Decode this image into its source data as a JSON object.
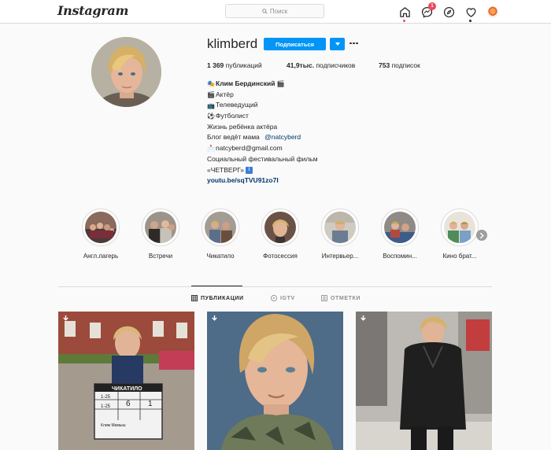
{
  "header": {
    "logo": "Instagram",
    "search_placeholder": "Поиск",
    "icons": [
      "home-icon",
      "messenger-icon",
      "explore-icon",
      "heart-icon",
      "avatar"
    ],
    "dm_badge": "1"
  },
  "profile": {
    "username": "klimberd",
    "follow_label": "Подписаться",
    "stats": {
      "posts_value": "1 369",
      "posts_label": "публикаций",
      "followers_value": "41,9тыс.",
      "followers_label": "подписчиков",
      "following_value": "753",
      "following_label": "подписок"
    },
    "bio": {
      "name": "Клим Бердинский",
      "lines": [
        "Актёр",
        "Телеведущий",
        "Футболист",
        "Жизнь ребёнка актёра",
        "Блог ведёт мама",
        "natcyberd@gmail.com",
        "Социальный фестивальный фильм",
        "«ЧЕТВЕРГ»"
      ],
      "mention": "@natcyberd",
      "url": "youtu.be/sqTVU91zo7I"
    }
  },
  "highlights": [
    {
      "label": "Англ.лагерь"
    },
    {
      "label": "Встречи"
    },
    {
      "label": "Чикатило"
    },
    {
      "label": "Фотосессия"
    },
    {
      "label": "Интервьер..."
    },
    {
      "label": "Воспомин..."
    },
    {
      "label": "Кино брат..."
    }
  ],
  "tabs": [
    {
      "label": "ПУБЛИКАЦИИ",
      "active": true
    },
    {
      "label": "IGTV",
      "active": false
    },
    {
      "label": "ОТМЕТКИ",
      "active": false
    }
  ],
  "clapperboard": {
    "title": "ЧИКАТИЛО",
    "numbers": [
      "6",
      "1"
    ],
    "rows": [
      "1-25",
      "1-25"
    ],
    "crew": "Клим Мамыш"
  },
  "colors": {
    "accent": "#0095f6",
    "link": "#00376b",
    "border": "#dbdbdb",
    "background": "#fafafa"
  }
}
